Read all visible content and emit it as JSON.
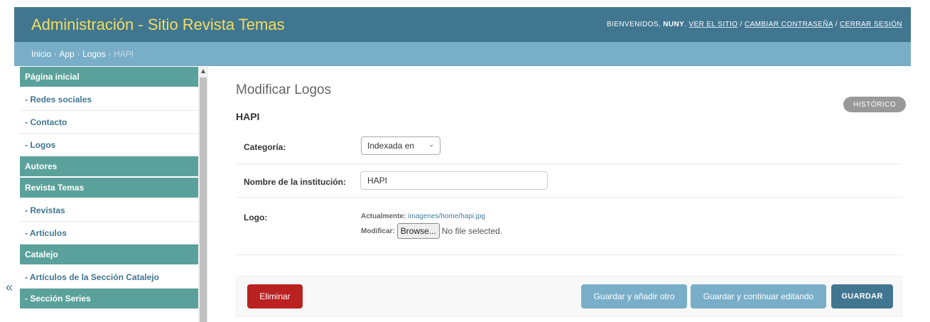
{
  "header": {
    "title": "Administración - Sitio Revista Temas",
    "welcome": "BIENVENIDOS,",
    "username": "NUNY",
    "view_site": "VER EL SITIO",
    "change_password": "CAMBIAR CONTRASEÑA",
    "logout": "CERRAR SESIÓN",
    "separator": "/"
  },
  "breadcrumbs": {
    "items": [
      "Inicio",
      "App",
      "Logos"
    ],
    "current": "HAPI",
    "separator": "›"
  },
  "sidebar": {
    "groups": [
      {
        "type": "head",
        "label": "Página inicial"
      },
      {
        "type": "item",
        "label": "- Redes sociales"
      },
      {
        "type": "item",
        "label": "- Contacto"
      },
      {
        "type": "item",
        "label": "- Logos"
      },
      {
        "type": "head",
        "label": "Autores"
      },
      {
        "type": "head",
        "label": "Revista Temas"
      },
      {
        "type": "item",
        "label": "- Revistas"
      },
      {
        "type": "item",
        "label": "- Artículos"
      },
      {
        "type": "head",
        "label": "Catalejo"
      },
      {
        "type": "item",
        "label": "- Artículos de la Sección Catalejo"
      },
      {
        "type": "head",
        "label": "- Sección Series"
      }
    ],
    "collapse_icon": "«"
  },
  "main": {
    "page_title": "Modificar Logos",
    "object_title": "HAPI",
    "history_button": "HISTÓRICO",
    "fields": {
      "categoria_label": "Categoría:",
      "categoria_value": "Indexada en",
      "nombre_label": "Nombre de la institución:",
      "nombre_value": "HAPI",
      "logo_label": "Logo:",
      "currently_label": "Actualmente:",
      "currently_value": "imagenes/home/hapi.jpg",
      "change_label": "Modificar:",
      "browse_button": "Browse...",
      "no_file": "No file selected."
    },
    "submit": {
      "delete": "Eliminar",
      "save_add_another": "Guardar y añadir otro",
      "save_continue": "Guardar y continuar editando",
      "save": "GUARDAR"
    }
  },
  "colors": {
    "header_bg": "#417690",
    "branding": "#f5dd5d",
    "breadcrumbs_bg": "#79aec8",
    "sidebar_head": "#5aa19b",
    "delete": "#ba2121"
  }
}
